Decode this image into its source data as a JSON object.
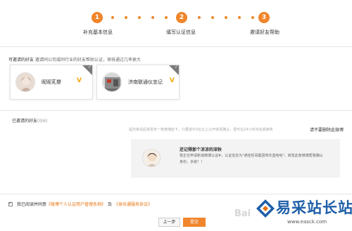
{
  "stepper": {
    "steps": [
      {
        "num": "1",
        "label": "补充基本信息"
      },
      {
        "num": "2",
        "label": "填写认证信息"
      },
      {
        "num": "3",
        "label": "邀请好友帮助"
      }
    ],
    "color": "#f0852b"
  },
  "invite": {
    "title": "可邀请的好友",
    "desc": "邀请同公司或同行业的好友帮助认证，审核通过几率更大",
    "friends": [
      {
        "name": "昵昵芤嬰",
        "badge": "V"
      },
      {
        "name": "济南联通仪忠记",
        "badge": "V"
      }
    ]
  },
  "invited": {
    "label": "已邀请的好友",
    "count": "(0/6)",
    "hint": "提交审请后将发布一条微博给下，只要其中3位以上公开转发确认，便可在24小时内完成审核",
    "no_post_link": "请不要删除此微博"
  },
  "preview": {
    "title": "还记得那个凉凉的深秋",
    "line1": "我正在申请新浪微博认证#，认证信息为\"通佳哲哥集团骨灰盒哈哈\"，转发此条微博帮我确认",
    "line2": "身份，多谢！！"
  },
  "agreement": {
    "prefix": "我已阅读并同意",
    "link1": "《微博个人认证用户管理条例》",
    "and": "及",
    "link2": "《身份通服务协议》"
  },
  "buttons": {
    "prev": "上一步",
    "submit": "提交"
  },
  "watermark": {
    "brand": "易采站长站",
    "url": "www.easck.com",
    "baidu": "Bai"
  },
  "colors": {
    "accent": "#f0852b",
    "link": "#e8730f",
    "vbadge": "#f0a800",
    "watermark_blue": "#1f5fa8"
  }
}
